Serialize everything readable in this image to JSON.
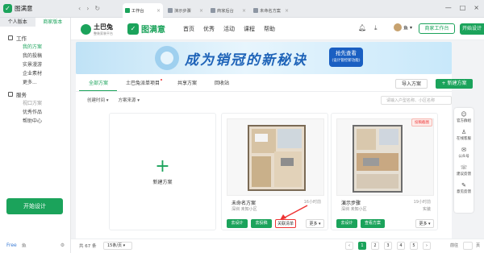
{
  "app": {
    "name": "图满意"
  },
  "tabs": [
    {
      "label": "工作台",
      "active": true
    },
    {
      "label": "演示步骤",
      "active": false
    },
    {
      "label": "商家后台",
      "active": false
    },
    {
      "label": "未命名方案",
      "active": false
    }
  ],
  "sidebar": {
    "version_personal": "个人版本",
    "version_merchant": "商家版本",
    "group_work": "工作",
    "work_items": [
      "我的方案",
      "我的投稿",
      "实景漫游",
      "企业素材",
      "更多..."
    ],
    "group_service": "服务",
    "service_items": [
      "视口方案",
      "优秀作品",
      "帮助中心"
    ],
    "start_design": "开始设计",
    "footer_edition": "Free",
    "footer_user": "鱼"
  },
  "topnav": {
    "brand1": "土巴兔",
    "brand1_sub": "整装家装平台",
    "brand2": "图满意",
    "menu": [
      "首页",
      "优秀",
      "活动",
      "课程",
      "帮助"
    ],
    "user_name": "鱼",
    "merchant_btn": "商家工作台",
    "start_btn": "开始设计"
  },
  "banner": {
    "headline": "成为销冠的新秘诀",
    "cta": "抢先查看",
    "cta_sub": "(设计管控新功能)"
  },
  "content": {
    "tabs": [
      "全部方案",
      "土巴兔派单项目",
      "共享方案",
      "回收站"
    ],
    "import_btn": "导入方案",
    "new_btn": "+ 新建方案",
    "filter_time": "创建时间",
    "filter_source": "方案来源",
    "search_placeholder": "请输入户型名称、小区名称",
    "new_card_label": "新建方案",
    "cards": [
      {
        "name": "未命名方案",
        "date": "16小时前",
        "city": "深圳 未知小区",
        "design": "去设计",
        "submit": "去投稿",
        "quote": "关联清单",
        "more": "更多"
      },
      {
        "name": "演示步骤",
        "date": "19小时前",
        "city": "深圳 未知小区",
        "design": "去设计",
        "submit": "查看方案",
        "more": "更多",
        "badge": "投稿截图",
        "type": "实装"
      }
    ]
  },
  "rightbar": [
    "官方群组",
    "在线客服",
    "公众号",
    "建议反馈",
    "意见反馈"
  ],
  "pagination": {
    "total": "共 67 条",
    "page_size": "15条/页",
    "pages": [
      "1",
      "2",
      "3",
      "4",
      "5"
    ],
    "current": "1",
    "jump_label": "前往",
    "jump_value": "1",
    "page_suffix": "页"
  }
}
